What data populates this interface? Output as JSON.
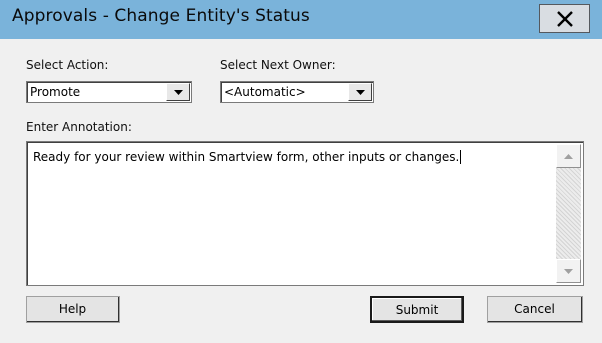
{
  "window": {
    "title": "Approvals - Change Entity's Status",
    "close_icon": "close-icon",
    "colors": {
      "titlebar": "#7ab3da",
      "background": "#f0f0f0"
    }
  },
  "form": {
    "action_label": "Select Action:",
    "action_value": "Promote",
    "owner_label": "Select Next Owner:",
    "owner_value": "<Automatic>",
    "annotation_label": "Enter Annotation:",
    "annotation_value": "Ready for your review within Smartview form, other inputs or changes."
  },
  "buttons": {
    "help": "Help",
    "submit": "Submit",
    "cancel": "Cancel"
  },
  "icons": {
    "dropdown": "chevron-down-icon",
    "scroll_up": "arrow-up-icon",
    "scroll_down": "arrow-down-icon"
  }
}
